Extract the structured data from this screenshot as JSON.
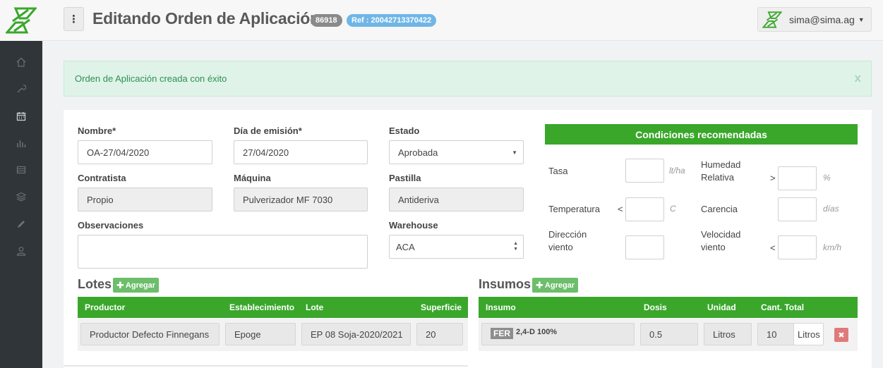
{
  "header": {
    "title": "Editando Orden de Aplicación",
    "id_badge": "86918",
    "ref_badge": "Ref : 20042713370422",
    "user_email": "sima@sima.ag",
    "menu_glyph": "⋮"
  },
  "sidebar": {
    "items": [
      "home-icon",
      "wrench-icon",
      "calendar-icon",
      "bar-chart-icon",
      "table-icon",
      "layers-icon",
      "pencil-icon",
      "user-icon"
    ]
  },
  "alert": {
    "message": "Orden de Aplicación creada con éxito",
    "close": "x"
  },
  "form": {
    "nombre_label": "Nombre*",
    "nombre_value": "OA-27/04/2020",
    "fecha_label": "Día de emisión*",
    "fecha_value": "27/04/2020",
    "estado_label": "Estado",
    "estado_value": "Aprobada",
    "contratista_label": "Contratista",
    "contratista_value": "Propio",
    "maquina_label": "Máquina",
    "maquina_value": "Pulverizador MF 7030",
    "pastilla_label": "Pastilla",
    "pastilla_value": "Antideriva",
    "observaciones_label": "Observaciones",
    "warehouse_label": "Warehouse",
    "warehouse_value": "ACA"
  },
  "conditions": {
    "title": "Condiciones recomendadas",
    "tasa_label": "Tasa",
    "tasa_unit": "lt/ha",
    "humedad_label_1": "Humedad",
    "humedad_label_2": "Relativa",
    "humedad_op": ">",
    "humedad_unit": "%",
    "temperatura_label": "Temperatura",
    "temperatura_op": "<",
    "temperatura_unit": "C",
    "carencia_label": "Carencia",
    "carencia_unit": "días",
    "direccion_label_1": "Dirección",
    "direccion_label_2": "viento",
    "velocidad_label_1": "Velocidad",
    "velocidad_label_2": "viento",
    "velocidad_op": "<",
    "velocidad_unit": "km/h"
  },
  "lotes": {
    "title": "Lotes",
    "add_label": "Agregar",
    "columns": [
      "Productor",
      "Establecimiento",
      "Lote",
      "Superficie"
    ],
    "rows": [
      {
        "productor": "Productor Defecto Finnegans",
        "establecimiento": "Epoge",
        "lote": "EP 08 Soja-2020/2021",
        "superficie": "20"
      }
    ]
  },
  "insumos": {
    "title": "Insumos",
    "add_label": "Agregar",
    "columns": [
      "Insumo",
      "Dosis",
      "Unidad",
      "Cant. Total"
    ],
    "rows": [
      {
        "tag": "FER",
        "insumo": "2,4-D 100%",
        "dosis": "0.5",
        "unidad": "Litros",
        "cantidad": "10",
        "cantidad_unidad": "Litros"
      }
    ]
  },
  "colors": {
    "accent_green": "#3aa72b",
    "sidebar_bg": "#2f3538",
    "alert_bg": "#dff3e8",
    "badge_blue": "#6fb6e6"
  }
}
